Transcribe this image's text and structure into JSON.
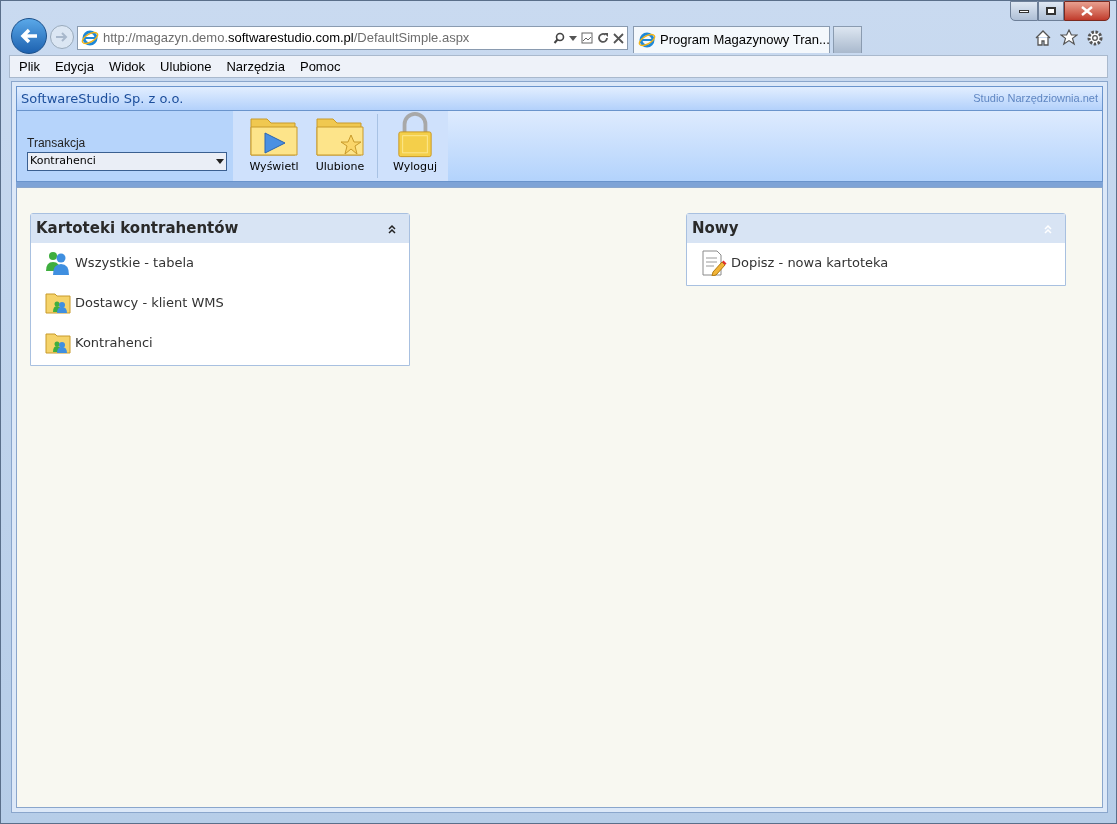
{
  "browser": {
    "address": {
      "prefix": "http://magazyn.demo.",
      "domain": "softwarestudio.com.pl",
      "path": "/DefaultSimple.aspx"
    },
    "tabs": [
      {
        "label": "Program Magazynowy Tran...",
        "selected": true
      }
    ],
    "menu": [
      "Plik",
      "Edycja",
      "Widok",
      "Ulubione",
      "Narzędzia",
      "Pomoc"
    ]
  },
  "header": {
    "company": "SoftwareStudio Sp. z o.o.",
    "brand": "Studio Narzędziownia.net"
  },
  "toolbar": {
    "select_label": "Transakcja",
    "select_value": "Kontrahenci",
    "buttons": [
      {
        "kind": "play",
        "label": "Wyświetl"
      },
      {
        "kind": "star",
        "label": "Ulubione"
      },
      {
        "kind": "lock",
        "label": "Wyloguj"
      }
    ]
  },
  "panels": [
    {
      "title": "Kartoteki kontrahentów",
      "collapse_dimmed": false,
      "items": [
        {
          "kind": "people",
          "label": "Wszystkie - tabela"
        },
        {
          "kind": "folder",
          "label": "Dostawcy - klient WMS"
        },
        {
          "kind": "folder",
          "label": "Kontrahenci"
        }
      ]
    },
    {
      "title": "Nowy",
      "collapse_dimmed": true,
      "items": [
        {
          "kind": "note",
          "label": "Dopisz - nowa kartoteka"
        }
      ]
    }
  ]
}
